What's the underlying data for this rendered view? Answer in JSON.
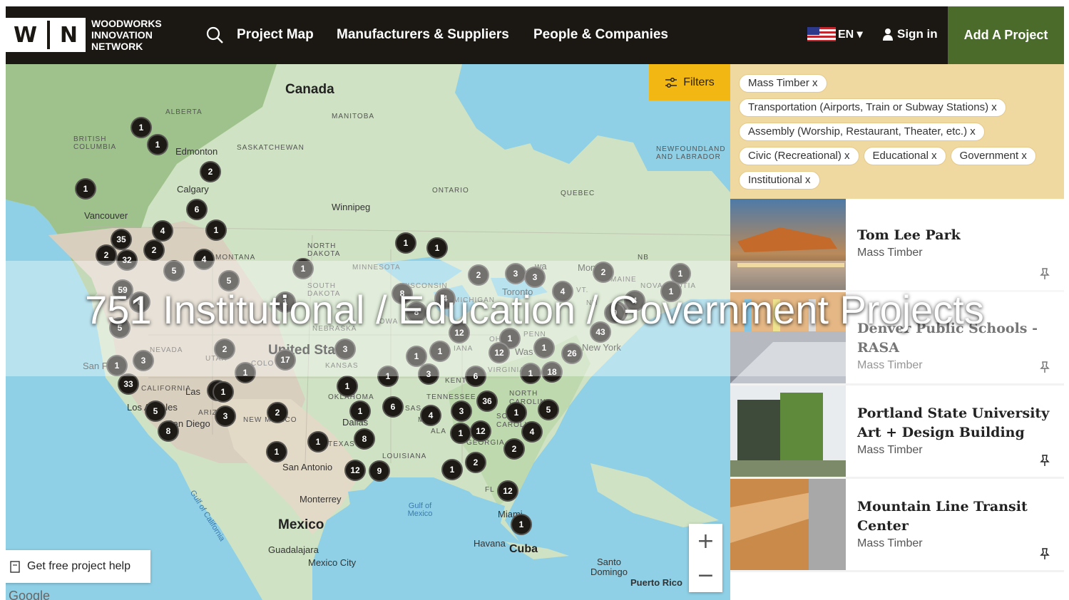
{
  "logo": {
    "letters": [
      "W",
      "N"
    ],
    "line1": "WOODWORKS",
    "line2": "INNOVATION",
    "line3": "NETWORK"
  },
  "nav": {
    "project_map": "Project Map",
    "manufacturers": "Manufacturers & Suppliers",
    "people": "People & Companies"
  },
  "header": {
    "lang": "EN ▾",
    "sign_in": "Sign in",
    "add_project": "Add A Project"
  },
  "map": {
    "filters_label": "Filters",
    "help_label": "Get free project help",
    "google": "Google",
    "labels": {
      "canada": "Canada",
      "alberta": "ALBERTA",
      "british_columbia": "BRITISH COLUMBIA",
      "saskatchewan": "SASKATCHEWAN",
      "manitoba": "MANITOBA",
      "ontario": "ONTARIO",
      "quebec": "QUEBEC",
      "newfoundland": "NEWFOUNDLAND AND LABRADOR",
      "edmonton": "Edmonton",
      "calgary": "Calgary",
      "vancouver": "Vancouver",
      "winnipeg": "Winnipeg",
      "montana": "MONTANA",
      "north_dakota": "NORTH DAKOTA",
      "south_dakota": "SOUTH DAKOTA",
      "minnesota": "MINNESOTA",
      "wisconsin": "WISCONSIN",
      "michigan": "MICHIGAN",
      "nebraska": "NEBRASKA",
      "iowa": "IOWA",
      "toronto": "Toronto",
      "nb": "NB",
      "maine": "MAINE",
      "nova_scotia": "NOVA SCOTIA",
      "vt": "VT.",
      "nh": "NH",
      "new_york": "New York",
      "nevada": "NEVADA",
      "utah": "UTAH",
      "colorado": "COLO",
      "kansas": "KANSAS",
      "united_states": "United States",
      "california": "CALIFORNIA",
      "arizona": "ARIZ",
      "new_mexico": "NEW MEXICO",
      "oklahoma": "OKLAHOMA",
      "texas": "TEXAS",
      "dallas": "Dallas",
      "san_antonio": "San Antonio",
      "louisiana": "LOUISIANA",
      "tennessee": "TENNESSEE",
      "georgia": "GEORGIA",
      "north_carolina": "NORTH CAROLINA",
      "south_carolina": "SO CAROLINA",
      "virginia": "VIRGINIA",
      "kentucky": "KENT",
      "indiana": "IANA",
      "ohio": "OHIO",
      "penn": "PENN",
      "alabama": "ALA",
      "mississippi": "MISSI",
      "arkansas": "SAS",
      "las_vegas": "Las",
      "san_francisco": "San F",
      "los_angeles": "Los Angeles",
      "san_diego": "San Diego",
      "monterrey": "Monterrey",
      "mexico": "Mexico",
      "guadalajara": "Guadalajara",
      "mexico_city": "Mexico City",
      "gulf_mexico": "Gulf of Mexico",
      "gulf_california": "Gulf of California",
      "havana": "Havana",
      "cuba": "Cuba",
      "miami": "Miami",
      "fl": "FL",
      "santo_domingo": "Santo Domingo",
      "puerto_rico": "Puerto Rico",
      "washington": "Was",
      "montreal": "Mon",
      "ottawa": "wa"
    },
    "clusters": [
      "1",
      "1",
      "2",
      "1",
      "6",
      "35",
      "2",
      "32",
      "4",
      "2",
      "4",
      "1",
      "5",
      "5",
      "59",
      "6",
      "5",
      "1",
      "3",
      "33",
      "5",
      "8",
      "1",
      "2",
      "3",
      "17",
      "1",
      "1",
      "2",
      "3",
      "1",
      "2",
      "1",
      "1",
      "1",
      "8",
      "4",
      "8",
      "12",
      "1",
      "3",
      "3",
      "4",
      "2",
      "4",
      "2",
      "1",
      "1",
      "1",
      "1",
      "9",
      "43",
      "1",
      "12",
      "26",
      "18",
      "6",
      "1",
      "1",
      "6",
      "4",
      "3",
      "36",
      "1",
      "5",
      "4",
      "1",
      "12",
      "2",
      "2",
      "1",
      "8",
      "12",
      "9",
      "1",
      "12",
      "1",
      "1",
      "3",
      "1",
      "1"
    ]
  },
  "filters": [
    "Mass Timber x",
    "Transportation (Airports, Train or Subway Stations) x",
    "Assembly (Worship, Restaurant, Theater, etc.) x",
    "Civic (Recreational) x",
    "Educational x",
    "Government x",
    "Institutional x"
  ],
  "projects": [
    {
      "title": "Tom Lee Park",
      "category": "Mass Timber"
    },
    {
      "title": "Denver Public Schools - RASA",
      "category": "Mass Timber"
    },
    {
      "title": "Portland State University Art + Design Building",
      "category": "Mass Timber"
    },
    {
      "title": "Mountain Line Transit Center",
      "category": "Mass Timber"
    }
  ],
  "overlay_title": "751 Institutional / Education / Government Projects"
}
